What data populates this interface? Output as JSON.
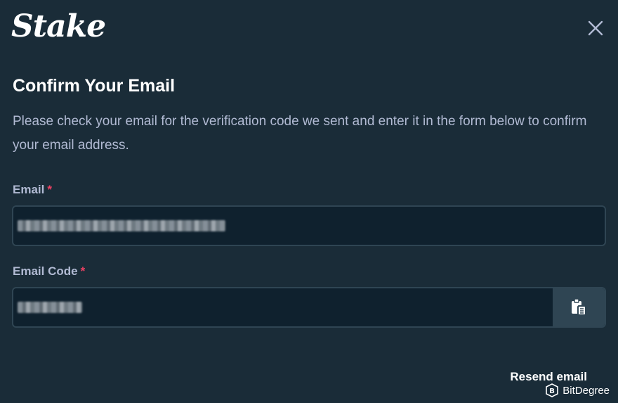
{
  "brand": {
    "logo_text": "Stake"
  },
  "dialog": {
    "title": "Confirm Your Email",
    "description": "Please check your email for the verification code we sent and enter it in the form below to confirm your email address.",
    "close_icon": "close-icon"
  },
  "form": {
    "email": {
      "label": "Email",
      "required_marker": "*",
      "value_obscured": true
    },
    "email_code": {
      "label": "Email Code",
      "required_marker": "*",
      "value_obscured": true,
      "paste_icon": "clipboard-paste-icon"
    },
    "resend_label": "Resend email"
  },
  "watermark": {
    "text": "BitDegree",
    "icon": "bitdegree-logo-icon"
  },
  "colors": {
    "background": "#1a2c38",
    "input_background": "#0f212e",
    "input_border": "#2f4553",
    "paste_button": "#2f4553",
    "muted_text": "#b1bad3",
    "required": "#ed4163",
    "text": "#ffffff"
  }
}
